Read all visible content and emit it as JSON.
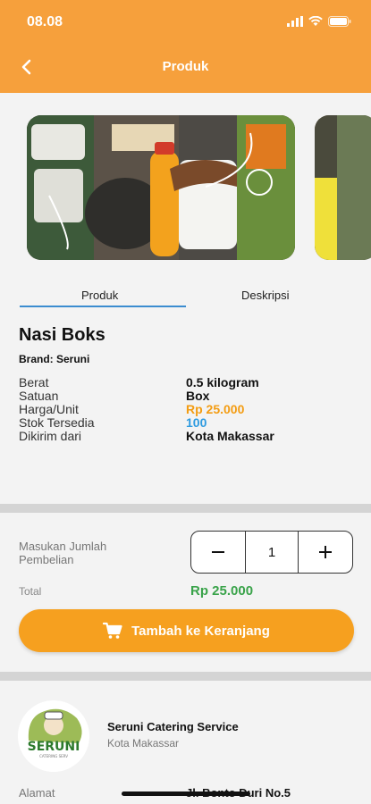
{
  "status": {
    "time": "08.08"
  },
  "header": {
    "title": "Produk"
  },
  "tabs": [
    {
      "label": "Produk"
    },
    {
      "label": "Deskripsi"
    }
  ],
  "product": {
    "name": "Nasi Boks",
    "brand": "Brand: Seruni",
    "specs": [
      {
        "label": "Berat",
        "value": "0.5 kilogram"
      },
      {
        "label": "Satuan",
        "value": "Box"
      },
      {
        "label": "Harga/Unit",
        "value": "Rp 25.000"
      },
      {
        "label": "Stok Tersedia",
        "value": "100"
      },
      {
        "label": "Dikirim dari",
        "value": "Kota Makassar"
      }
    ]
  },
  "purchase": {
    "quantity_label": "Masukan Jumlah Pembelian",
    "quantity_label_line1": "Masukan Jumlah",
    "quantity_label_line2": "Pembelian",
    "quantity": "1",
    "total_label": "Total",
    "total_value": "Rp 25.000",
    "add_to_cart": "Tambah ke Keranjang"
  },
  "seller": {
    "name": "Seruni Catering Service",
    "city": "Kota Makassar",
    "address_label": "Alamat",
    "address_value": "Jl. Bonto Duri No.5",
    "logo_text": "SERUNI",
    "logo_subtext": "CATERING SERV"
  },
  "colors": {
    "header": "#f6a03c",
    "price": "#f39c12",
    "stock": "#2e9be0",
    "total": "#3aa34a",
    "button": "#f6a01f"
  },
  "icons": [
    "back-arrow-icon",
    "signal-icon",
    "wifi-icon",
    "battery-icon",
    "cart-icon",
    "minus-icon",
    "plus-icon"
  ]
}
